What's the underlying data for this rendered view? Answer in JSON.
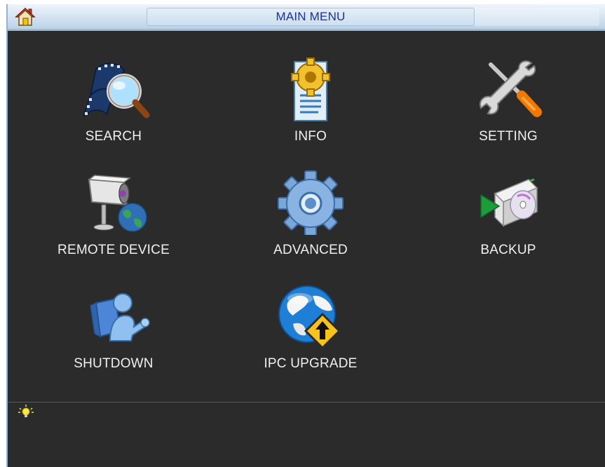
{
  "window": {
    "title": "MAIN MENU",
    "home_icon": "home-icon"
  },
  "menu": {
    "items": [
      {
        "label": "SEARCH",
        "icon": "film-magnifier-icon"
      },
      {
        "label": "INFO",
        "icon": "document-gear-icon"
      },
      {
        "label": "SETTING",
        "icon": "wrench-screwdriver-icon"
      },
      {
        "label": "REMOTE DEVICE",
        "icon": "camera-globe-icon"
      },
      {
        "label": "ADVANCED",
        "icon": "gear-icon"
      },
      {
        "label": "BACKUP",
        "icon": "disc-drive-icon"
      },
      {
        "label": "SHUTDOWN",
        "icon": "user-shutdown-icon"
      },
      {
        "label": "IPC UPGRADE",
        "icon": "globe-upgrade-icon"
      }
    ]
  },
  "status_bar": {
    "tip_icon": "lightbulb-icon",
    "tip_text": ""
  },
  "colors": {
    "background": "#2b2b2b",
    "title_text": "#1e2fa0",
    "label_text": "#f0f0f0",
    "titlebar": "#d4e3f1"
  }
}
